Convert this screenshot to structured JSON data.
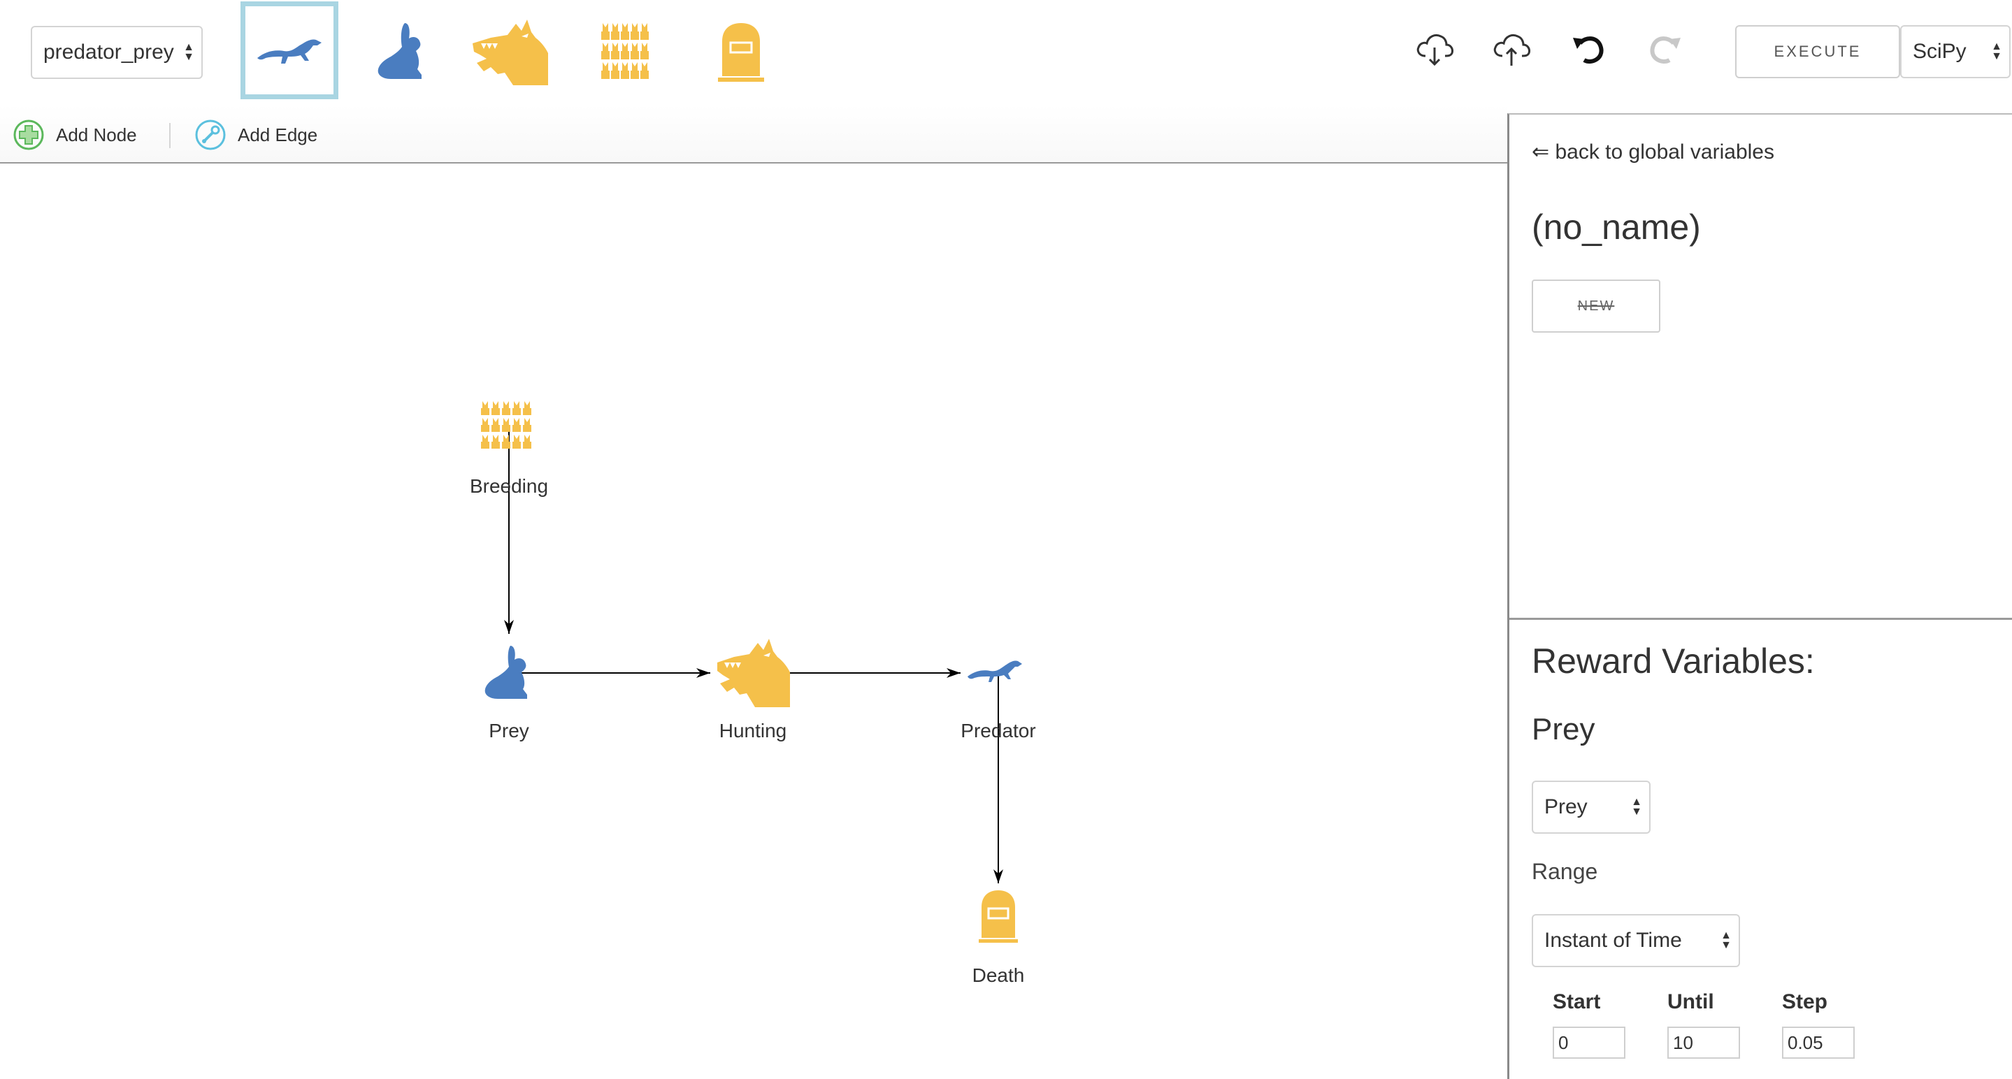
{
  "toolbar": {
    "model_select": {
      "value": "predator_prey"
    },
    "palette": [
      "predator",
      "prey",
      "hunting",
      "breeding",
      "death"
    ],
    "selected_palette": "predator",
    "tools": [
      "cloud-download-icon",
      "cloud-upload-icon",
      "undo-icon",
      "redo-icon"
    ],
    "execute_label": "EXECUTE",
    "engine_select": {
      "value": "SciPy"
    }
  },
  "subtoolbar": {
    "add_node_label": "Add Node",
    "add_edge_label": "Add Edge"
  },
  "graph": {
    "nodes": [
      {
        "id": "breeding",
        "label": "Breeding",
        "icon": "breeding-icon",
        "color": "#f5c04a"
      },
      {
        "id": "prey",
        "label": "Prey",
        "icon": "rabbit-icon",
        "color": "#4a7dc0"
      },
      {
        "id": "hunting",
        "label": "Hunting",
        "icon": "hunting-icon",
        "color": "#f5c04a"
      },
      {
        "id": "predator",
        "label": "Predator",
        "icon": "weasel-icon",
        "color": "#4a7dc0"
      },
      {
        "id": "death",
        "label": "Death",
        "icon": "tombstone-icon",
        "color": "#f5c04a"
      }
    ],
    "edges": [
      {
        "from": "breeding",
        "to": "prey"
      },
      {
        "from": "prey",
        "to": "hunting"
      },
      {
        "from": "hunting",
        "to": "predator"
      },
      {
        "from": "predator",
        "to": "death"
      }
    ]
  },
  "right_panel": {
    "back_link": "⇐ back to global variables",
    "variable_name": "(no_name)",
    "new_button": "NEW",
    "reward_title": "Reward Variables:",
    "reward_subtitle": "Prey",
    "reward_select": {
      "value": "Prey"
    },
    "range_label": "Range",
    "range_select": {
      "value": "Instant of Time"
    },
    "start_label": "Start",
    "until_label": "Until",
    "step_label": "Step",
    "start_value": "0",
    "until_value": "10",
    "step_value": "0.05"
  },
  "colors": {
    "blue": "#4a7dc0",
    "yellow": "#f5c04a",
    "selected_border": "#a9d5e2"
  }
}
